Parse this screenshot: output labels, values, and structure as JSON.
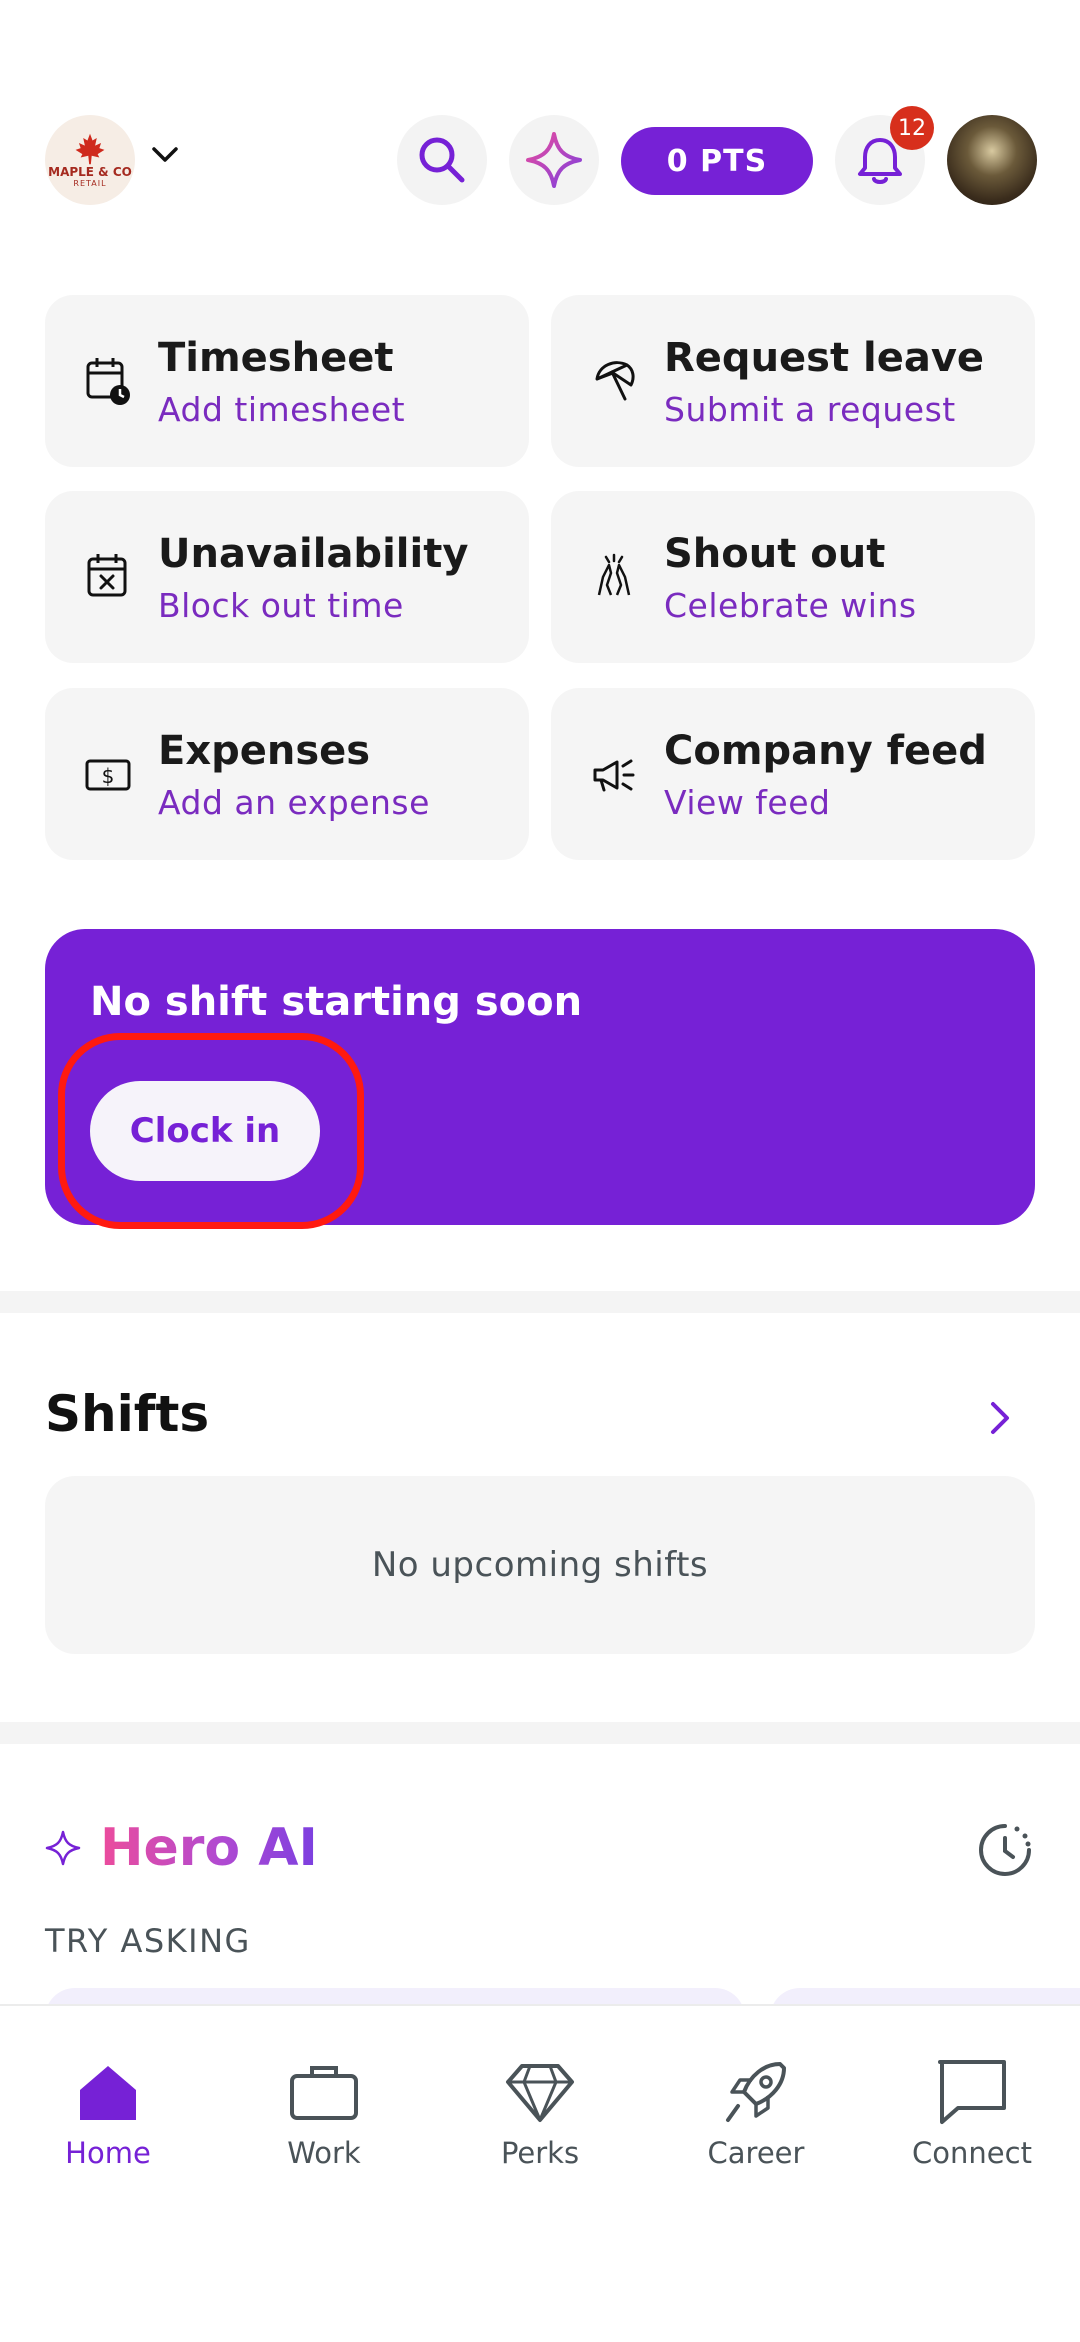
{
  "header": {
    "logo_text": "MAPLE & CO",
    "logo_sub": "RETAIL",
    "points_label": "0 PTS",
    "notification_count": "12"
  },
  "actions": [
    {
      "title": "Timesheet",
      "subtitle": "Add timesheet",
      "icon": "calendar-clock-icon"
    },
    {
      "title": "Request leave",
      "subtitle": "Submit a request",
      "icon": "umbrella-icon"
    },
    {
      "title": "Unavailability",
      "subtitle": "Block out time",
      "icon": "calendar-x-icon"
    },
    {
      "title": "Shout out",
      "subtitle": "Celebrate wins",
      "icon": "high-five-icon"
    },
    {
      "title": "Expenses",
      "subtitle": "Add an expense",
      "icon": "dollar-bill-icon"
    },
    {
      "title": "Company feed",
      "subtitle": "View feed",
      "icon": "megaphone-icon"
    }
  ],
  "shift_banner": {
    "title": "No shift starting soon",
    "button": "Clock in"
  },
  "shifts": {
    "title": "Shifts",
    "empty_text": "No upcoming shifts"
  },
  "hero_ai": {
    "title": "Hero AI",
    "try_label": "TRY ASKING"
  },
  "nav": [
    {
      "label": "Home",
      "active": true
    },
    {
      "label": "Work",
      "active": false
    },
    {
      "label": "Perks",
      "active": false
    },
    {
      "label": "Career",
      "active": false
    },
    {
      "label": "Connect",
      "active": false
    }
  ],
  "colors": {
    "accent": "#7621d6",
    "badge": "#d72f1c",
    "highlight": "#ff1a10"
  }
}
